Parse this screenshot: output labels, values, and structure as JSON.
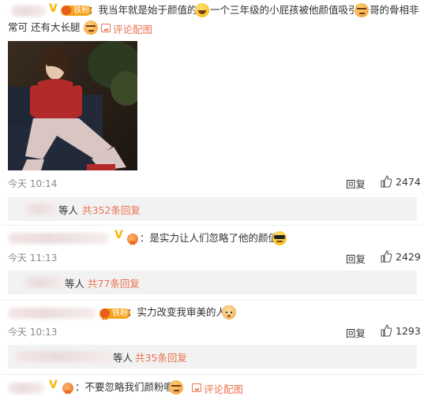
{
  "comments": [
    {
      "text_line1": "：我当年就是始于颜值的",
      "text_mid": "一个三年级的小屁孩被他颜值吸引",
      "text_tail": "哥的骨相非",
      "text_line2": "常可 还有大长腿",
      "badge": "铁粉",
      "pic_link": "评论配图",
      "time": "今天 10:14",
      "reply_label": "回复",
      "likes": "2474",
      "replies_who": "等人",
      "replies_total": "共352条回复"
    },
    {
      "text": "：是实力让人们忽略了他的颜值",
      "time": "今天 11:13",
      "reply_label": "回复",
      "likes": "2429",
      "replies_who": "等人",
      "replies_total": "共77条回复"
    },
    {
      "text": "：实力改变我审美的人",
      "badge": "铁粉",
      "time": "今天 10:13",
      "reply_label": "回复",
      "likes": "1293",
      "replies_who": "等人",
      "replies_total": "共35条回复"
    },
    {
      "text": "：不要忽略我们颜粉喔",
      "pic_link": "评论配图"
    }
  ],
  "icons": {
    "verified": "verified-v-icon",
    "medal": "medal-icon",
    "thumb": "thumbs-up-icon",
    "pic": "image-icon"
  },
  "colors": {
    "link": "#eb7350",
    "badge": "#f7a21b",
    "verified": "#f7b600",
    "reply_bg": "#f2f2f2",
    "time": "#8a8a8a"
  }
}
